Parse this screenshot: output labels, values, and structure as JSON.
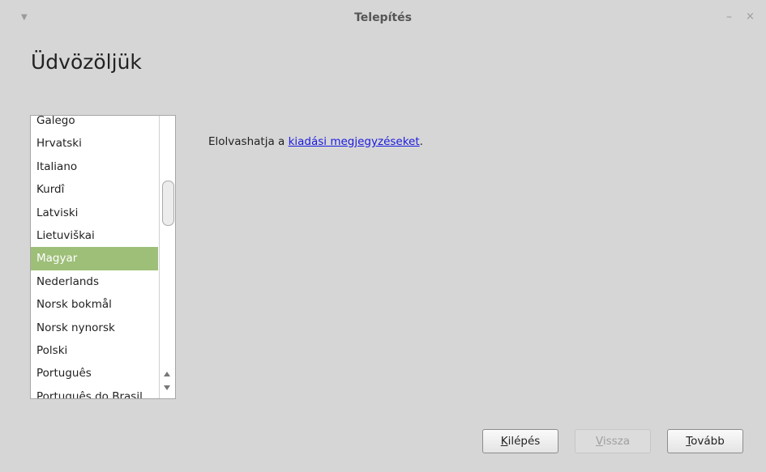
{
  "window": {
    "title": "Telepítés",
    "menu_glyph": "▼",
    "minimize_glyph": "–",
    "close_glyph": "×"
  },
  "heading": "Üdvözöljük",
  "languages": {
    "items": [
      "Galego",
      "Hrvatski",
      "Italiano",
      "Kurdî",
      "Latviski",
      "Lietuviškai",
      "Magyar",
      "Nederlands",
      "Norsk bokmål",
      "Norsk nynorsk",
      "Polski",
      "Português",
      "Português do Brasil"
    ],
    "selected": "Magyar"
  },
  "release_notes": {
    "prefix": "Elolvashatja a ",
    "link": "kiadási megjegyzéseket",
    "suffix": "."
  },
  "buttons": {
    "quit": {
      "accel": "K",
      "rest": "ilépés"
    },
    "back": {
      "accel": "V",
      "rest": "issza"
    },
    "next": {
      "accel": "T",
      "rest": "ovább"
    }
  },
  "icons": {
    "window_menu": "chevron-down-icon",
    "minimize": "minimize-icon",
    "close": "close-icon",
    "scroll_up": "arrow-up-icon",
    "scroll_down": "arrow-down-icon"
  },
  "colors": {
    "selection": "#9dbf78",
    "link": "#1a1ae0",
    "background": "#d6d6d6"
  }
}
